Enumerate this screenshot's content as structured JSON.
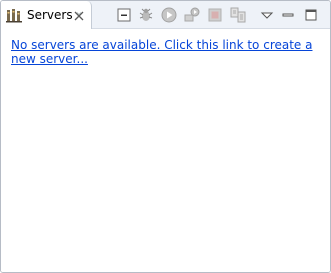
{
  "tab": {
    "title": "Servers",
    "icon": "servers-icon"
  },
  "toolbar": {
    "items": [
      {
        "name": "collapse-all-icon"
      },
      {
        "name": "debug-server-icon"
      },
      {
        "name": "start-server-icon"
      },
      {
        "name": "profile-server-icon"
      },
      {
        "name": "stop-server-icon"
      },
      {
        "name": "publish-icon"
      }
    ],
    "view_menu": "view-menu-chevron-icon",
    "minimize": "minimize-icon",
    "maximize": "maximize-icon"
  },
  "content": {
    "create_link": "No servers are available. Click this link to create a new server..."
  },
  "colors": {
    "link": "#0645d8",
    "header_bg": "#eef2f8",
    "border": "#b6bcc6"
  }
}
